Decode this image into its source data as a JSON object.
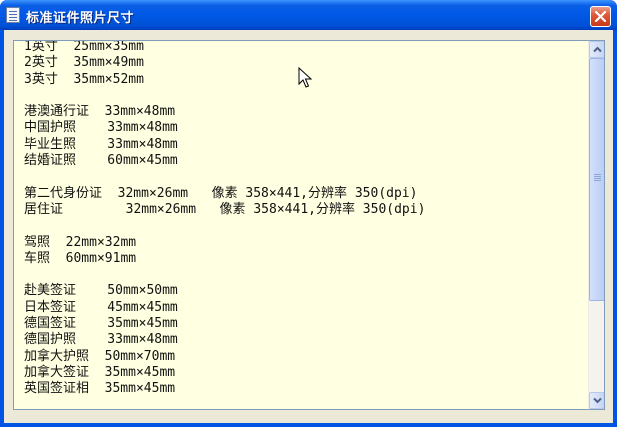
{
  "window": {
    "title": "标准证件照片尺寸"
  },
  "content": {
    "text": "1英寸  25mm×35mm\n2英寸  35mm×49mm\n3英寸  35mm×52mm\n\n港澳通行证  33mm×48mm\n中国护照    33mm×48mm\n毕业生照    33mm×48mm\n结婚证照    60mm×45mm\n\n第二代身份证  32mm×26mm   像素 358×441,分辨率 350(dpi)\n居住证        32mm×26mm   像素 358×441,分辨率 350(dpi)\n\n驾照  22mm×32mm\n车照  60mm×91mm\n\n赴美签证    50mm×50mm\n日本签证    45mm×45mm\n德国签证    35mm×45mm\n德国护照    33mm×48mm\n加拿大护照  50mm×70mm\n加拿大签证  35mm×45mm\n英国签证相  35mm×45mm"
  },
  "icons": {
    "app": "document-icon",
    "close": "close-icon",
    "scroll_up": "arrow-up-icon",
    "scroll_down": "arrow-down-icon",
    "pointer": "mouse-cursor-icon"
  },
  "colors": {
    "titlebar": "#0058e6",
    "close_button": "#e05a3a",
    "text_background": "#ffffe1"
  }
}
